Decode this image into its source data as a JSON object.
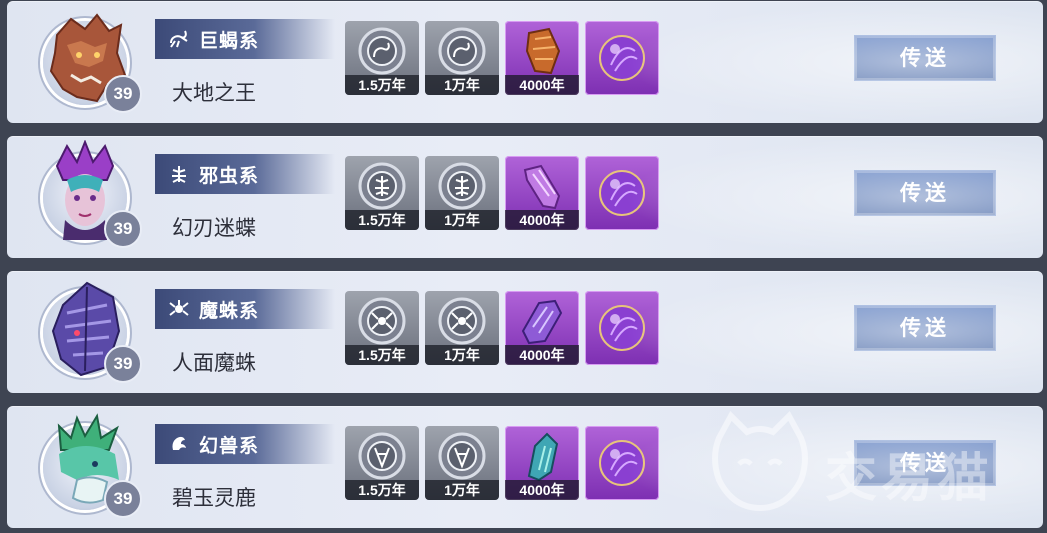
{
  "rows": [
    {
      "faction": "巨蝎系",
      "faction_icon": "scorpion-icon",
      "beast": "大地之王",
      "level": "39",
      "avatar_icon": "earth-king-portrait",
      "items": [
        {
          "label": "1.5万年",
          "kind": "soul-ring-scorpion-icon",
          "color": "gray"
        },
        {
          "label": "1万年",
          "kind": "soul-ring-scorpion-icon",
          "color": "gray"
        },
        {
          "label": "4000年",
          "kind": "soul-bone-icon",
          "color": "purple"
        },
        {
          "label": "",
          "kind": "purple-orb-icon",
          "color": "purple"
        }
      ],
      "button": "传送"
    },
    {
      "faction": "邪虫系",
      "faction_icon": "insect-icon",
      "beast": "幻刃迷蝶",
      "level": "39",
      "avatar_icon": "blade-butterfly-portrait",
      "items": [
        {
          "label": "1.5万年",
          "kind": "soul-ring-insect-icon",
          "color": "gray"
        },
        {
          "label": "1万年",
          "kind": "soul-ring-insect-icon",
          "color": "gray"
        },
        {
          "label": "4000年",
          "kind": "soul-bone-icon",
          "color": "purple"
        },
        {
          "label": "",
          "kind": "purple-orb-icon",
          "color": "purple"
        }
      ],
      "button": "传送"
    },
    {
      "faction": "魔蛛系",
      "faction_icon": "spider-icon",
      "beast": "人面魔蛛",
      "level": "39",
      "avatar_icon": "human-face-spider-portrait",
      "items": [
        {
          "label": "1.5万年",
          "kind": "soul-ring-spider-icon",
          "color": "gray"
        },
        {
          "label": "1万年",
          "kind": "soul-ring-spider-icon",
          "color": "gray"
        },
        {
          "label": "4000年",
          "kind": "soul-bone-icon",
          "color": "purple"
        },
        {
          "label": "",
          "kind": "purple-orb-icon",
          "color": "purple"
        }
      ],
      "button": "传送"
    },
    {
      "faction": "幻兽系",
      "faction_icon": "phantom-beast-icon",
      "beast": "碧玉灵鹿",
      "level": "39",
      "avatar_icon": "jade-deer-portrait",
      "items": [
        {
          "label": "1.5万年",
          "kind": "soul-ring-beast-icon",
          "color": "gray"
        },
        {
          "label": "1万年",
          "kind": "soul-ring-beast-icon",
          "color": "gray"
        },
        {
          "label": "4000年",
          "kind": "soul-bone-icon",
          "color": "purple"
        },
        {
          "label": "",
          "kind": "purple-orb-icon",
          "color": "purple"
        }
      ],
      "button": "传送"
    }
  ],
  "watermark": "交易猫",
  "colors": {
    "button": "#4f70ae",
    "faction_bar": "#3c4a78",
    "purple_item": "#9a48c8"
  }
}
